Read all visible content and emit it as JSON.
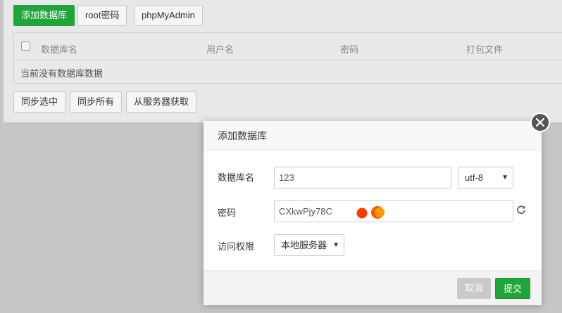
{
  "toolbar": {
    "add_db": "添加数据库",
    "root_password": "root密码",
    "phpmyadmin": "phpMyAdmin"
  },
  "table": {
    "columns": [
      "数据库名",
      "用户名",
      "密码",
      "打包文件"
    ],
    "empty_text": "当前没有数据库数据"
  },
  "bottom_actions": {
    "sync_selected": "同步选中",
    "sync_all": "同步所有",
    "fetch_from_server": "从服务器获取"
  },
  "modal": {
    "title": "添加数据库",
    "db_name_label": "数据库名",
    "db_name_value": "123",
    "charset_value": "utf-8",
    "password_label": "密码",
    "password_value": "CXkwPjy78C",
    "access_label": "访问权限",
    "access_value": "本地服务器",
    "cancel_label": "取消",
    "submit_label": "提交"
  },
  "colors": {
    "accent_green": "#20a53a",
    "dot_red": "#ff3b00",
    "dot_orange": "#ff8a00"
  },
  "icons": [
    "close-icon",
    "refresh-icon",
    "caret-down-icon",
    "checkbox"
  ]
}
